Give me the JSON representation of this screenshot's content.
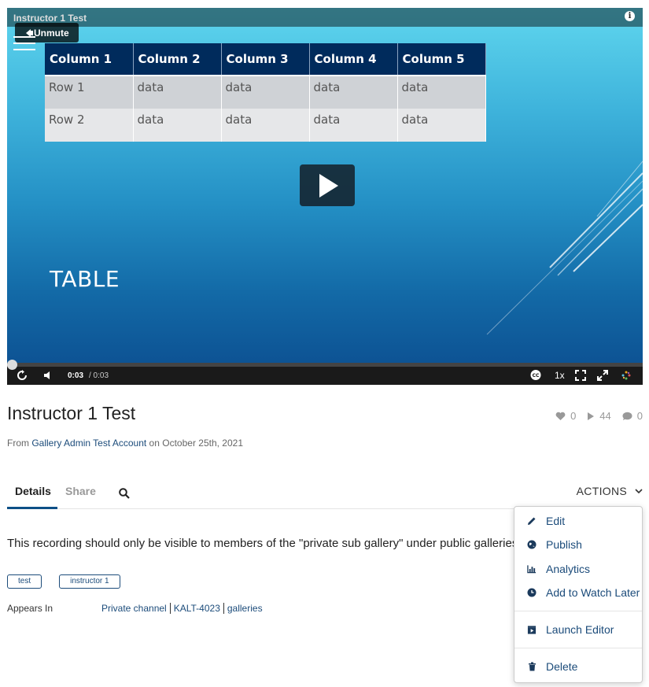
{
  "player": {
    "title": "Instructor 1 Test",
    "unmute_label": "Unmute",
    "slide": {
      "table_headers": [
        "Column 1",
        "Column 2",
        "Column 3",
        "Column 4",
        "Column 5"
      ],
      "rows": [
        [
          "Row 1",
          "data",
          "data",
          "data",
          "data"
        ],
        [
          "Row 2",
          "data",
          "data",
          "data",
          "data"
        ]
      ],
      "heading": "TABLE"
    },
    "time_current": "0:03",
    "time_total": "/ 0:03",
    "speed": "1x",
    "progress": 0.0
  },
  "entry": {
    "title": "Instructor 1 Test",
    "likes": "0",
    "plays": "44",
    "comments": "0",
    "from_prefix": "From",
    "owner": "Gallery Admin Test Account",
    "date_prefix": "on",
    "date": "October 25th, 2021"
  },
  "tabs": {
    "details": "Details",
    "share": "Share",
    "actions": "ACTIONS"
  },
  "details": {
    "description": "This recording should only be visible to members of the \"private sub gallery\" under public galleries",
    "tags": [
      "test",
      "instructor 1"
    ],
    "appears_label": "Appears In",
    "appears_in": [
      "Private channel",
      "KALT-4023",
      "galleries"
    ]
  },
  "actions_menu": {
    "edit": "Edit",
    "publish": "Publish",
    "analytics": "Analytics",
    "watch_later": "Add to Watch Later",
    "launch_editor": "Launch Editor",
    "delete": "Delete"
  },
  "colors": {
    "link": "#1b4b7a",
    "tab_underline": "#0d4f86",
    "table_header": "#002b5c"
  }
}
